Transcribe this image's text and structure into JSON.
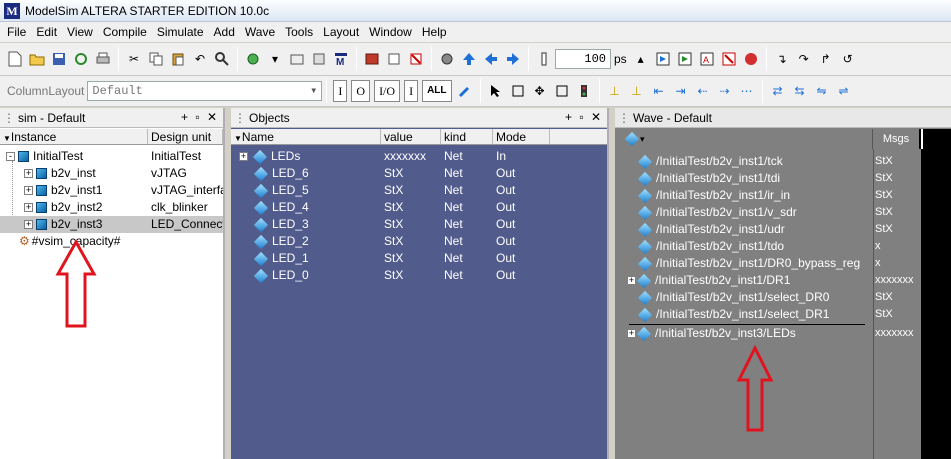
{
  "window": {
    "title": "ModelSim ALTERA STARTER EDITION 10.0c",
    "logo_text": "M"
  },
  "menu": [
    "File",
    "Edit",
    "View",
    "Compile",
    "Simulate",
    "Add",
    "Wave",
    "Tools",
    "Layout",
    "Window",
    "Help"
  ],
  "toolbar": {
    "time_value": "100",
    "time_unit": "ps",
    "column_layout_label": "ColumnLayout",
    "column_layout_value": "Default",
    "text_buttons": [
      "I",
      "O",
      "I/O",
      "I",
      "ALL"
    ]
  },
  "sim_pane": {
    "title": "sim - Default",
    "columns": [
      "Instance",
      "Design unit"
    ],
    "rows": [
      {
        "name": "InitialTest",
        "unit": "InitialTest",
        "indent": 0,
        "expander": "-"
      },
      {
        "name": "b2v_inst",
        "unit": "vJTAG",
        "indent": 1,
        "expander": "+"
      },
      {
        "name": "b2v_inst1",
        "unit": "vJTAG_interfac",
        "indent": 1,
        "expander": "+"
      },
      {
        "name": "b2v_inst2",
        "unit": "clk_blinker",
        "indent": 1,
        "expander": "+"
      },
      {
        "name": "b2v_inst3",
        "unit": "LED_Connector",
        "indent": 1,
        "expander": "+",
        "selected": true
      },
      {
        "name": "#vsim_capacity#",
        "unit": "",
        "indent": 0,
        "expander": ""
      }
    ]
  },
  "objects_pane": {
    "title": "Objects",
    "columns": [
      "Name",
      "value",
      "kind",
      "Mode"
    ],
    "rows": [
      {
        "name": "LEDs",
        "value": "xxxxxxx",
        "kind": "Net",
        "mode": "In",
        "expander": "+"
      },
      {
        "name": "LED_6",
        "value": "StX",
        "kind": "Net",
        "mode": "Out"
      },
      {
        "name": "LED_5",
        "value": "StX",
        "kind": "Net",
        "mode": "Out"
      },
      {
        "name": "LED_4",
        "value": "StX",
        "kind": "Net",
        "mode": "Out"
      },
      {
        "name": "LED_3",
        "value": "StX",
        "kind": "Net",
        "mode": "Out"
      },
      {
        "name": "LED_2",
        "value": "StX",
        "kind": "Net",
        "mode": "Out"
      },
      {
        "name": "LED_1",
        "value": "StX",
        "kind": "Net",
        "mode": "Out"
      },
      {
        "name": "LED_0",
        "value": "StX",
        "kind": "Net",
        "mode": "Out"
      }
    ]
  },
  "wave_pane": {
    "title": "Wave - Default",
    "msgs_label": "Msgs",
    "signals": [
      {
        "path": "/InitialTest/b2v_inst1/tck",
        "value": "StX",
        "expander": ""
      },
      {
        "path": "/InitialTest/b2v_inst1/tdi",
        "value": "StX",
        "expander": ""
      },
      {
        "path": "/InitialTest/b2v_inst1/ir_in",
        "value": "StX",
        "expander": ""
      },
      {
        "path": "/InitialTest/b2v_inst1/v_sdr",
        "value": "StX",
        "expander": ""
      },
      {
        "path": "/InitialTest/b2v_inst1/udr",
        "value": "StX",
        "expander": ""
      },
      {
        "path": "/InitialTest/b2v_inst1/tdo",
        "value": "x",
        "expander": ""
      },
      {
        "path": "/InitialTest/b2v_inst1/DR0_bypass_reg",
        "value": "x",
        "expander": ""
      },
      {
        "path": "/InitialTest/b2v_inst1/DR1",
        "value": "xxxxxxx",
        "expander": "+"
      },
      {
        "path": "/InitialTest/b2v_inst1/select_DR0",
        "value": "StX",
        "expander": ""
      },
      {
        "path": "/InitialTest/b2v_inst1/select_DR1",
        "value": "StX",
        "expander": ""
      },
      {
        "path": "/InitialTest/b2v_inst3/LEDs",
        "value": "xxxxxxx",
        "expander": "+"
      }
    ]
  },
  "colors": {
    "objects_bg": "#525c8c",
    "wave_bg": "#808080",
    "annotation_red": "#e0141e",
    "selection": "#c8c8c8"
  }
}
